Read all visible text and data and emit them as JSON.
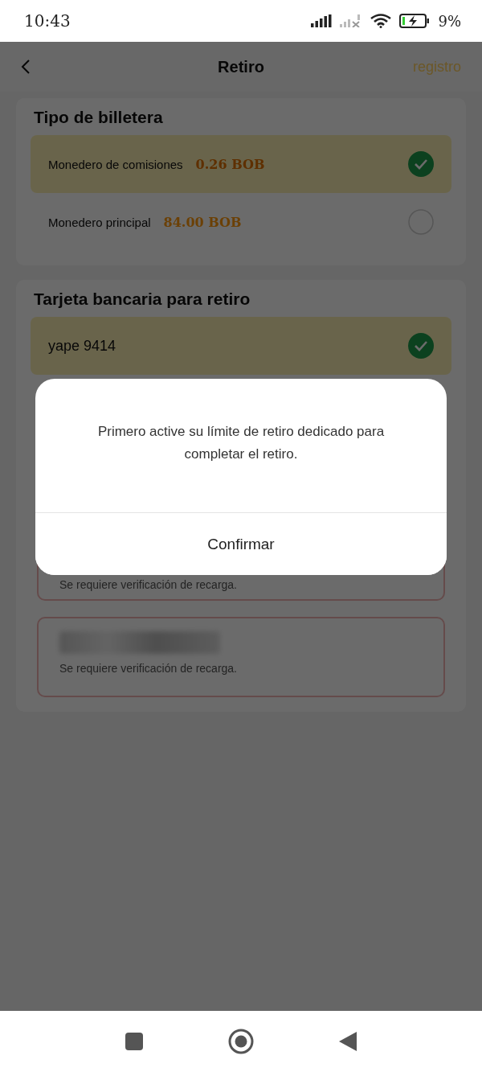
{
  "status_bar": {
    "time": "10:43",
    "battery": "9%"
  },
  "header": {
    "title": "Retiro",
    "action": "registro"
  },
  "wallet_section": {
    "title": "Tipo de billetera",
    "wallets": [
      {
        "name": "Monedero de comisiones",
        "amount": "0.26 BOB",
        "selected": true
      },
      {
        "name": "Monedero principal",
        "amount": "84.00 BOB",
        "selected": false
      }
    ]
  },
  "bank_section": {
    "title": "Tarjeta bancaria para retiro",
    "cards": [
      {
        "kind": "account",
        "name": "yape 9414",
        "selected": true
      },
      {
        "kind": "locked",
        "note": "Se requiere verificación de recarga."
      },
      {
        "kind": "locked_blurred",
        "note": "Se requiere verificación de recarga."
      }
    ]
  },
  "dialog": {
    "message": "Primero active su límite de retiro dedicado para completar el retiro.",
    "button": "Confirmar"
  }
}
